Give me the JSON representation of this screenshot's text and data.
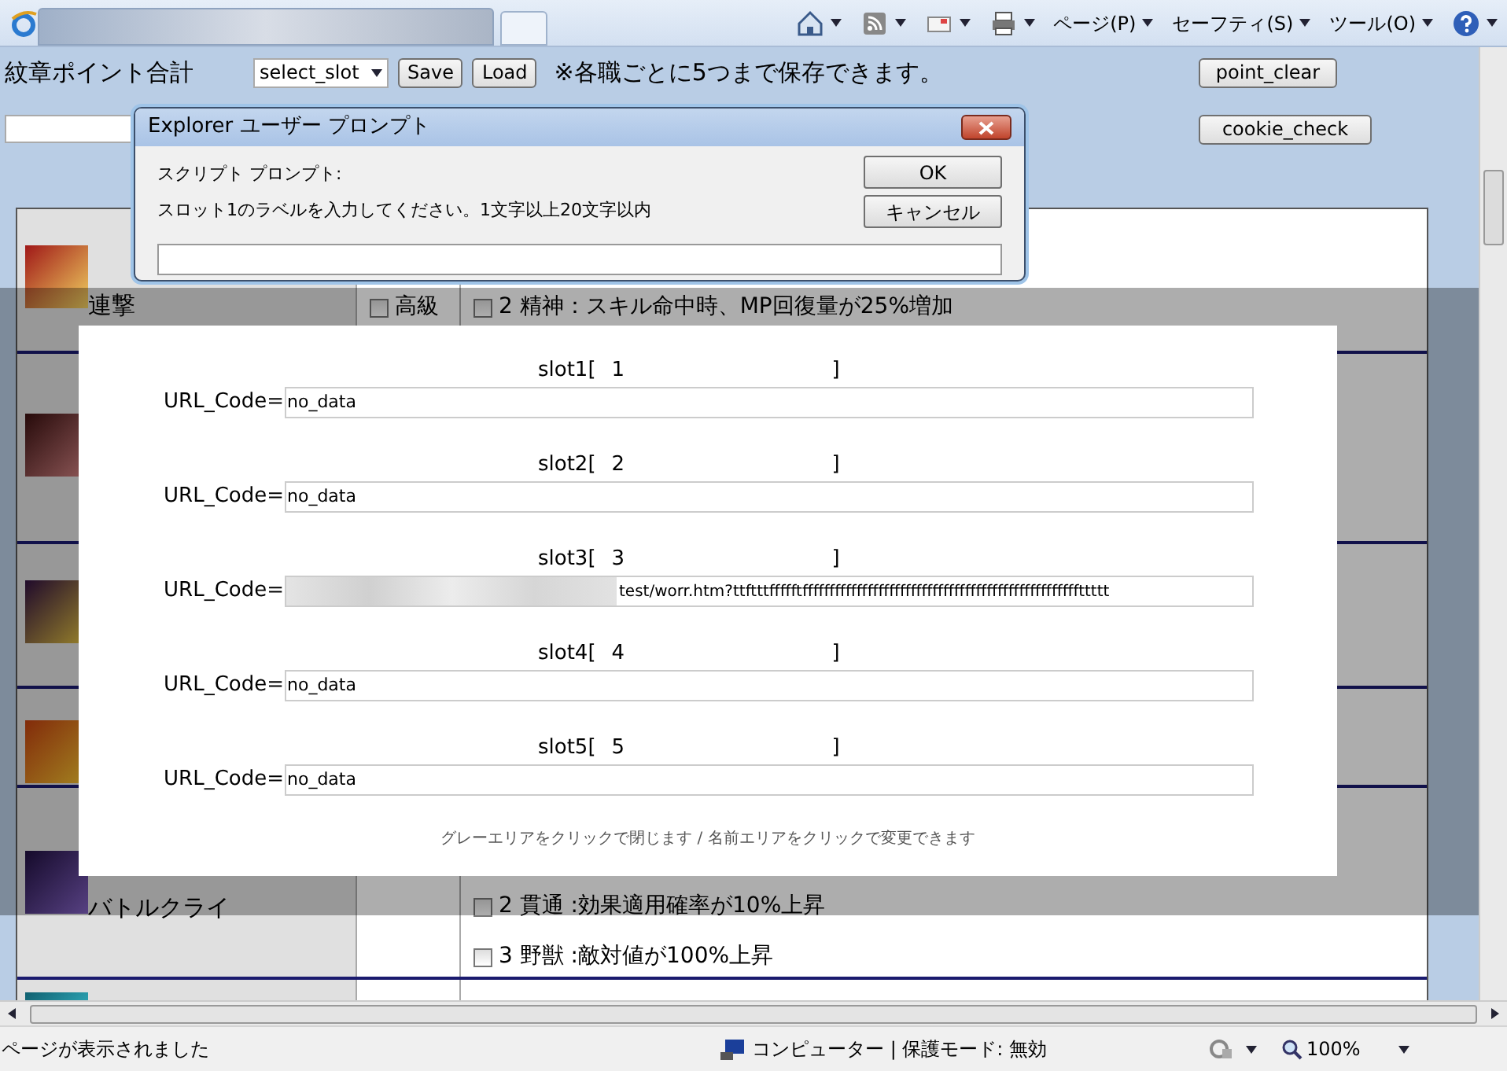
{
  "browser": {
    "menus": [
      "ページ(P)",
      "セーフティ(S)",
      "ツール(O)"
    ]
  },
  "page": {
    "title": "紋章ポイント合計",
    "slot_select": "select_slot",
    "buttons": [
      "Save",
      "Load"
    ],
    "notice": "※各職ごとに5つまで保存できます。",
    "point_clear": "point_clear",
    "cookie_check": "cookie_check"
  },
  "skills": [
    {
      "kind": "skill",
      "name": "連撃",
      "grade": "高級",
      "grade_checked": false,
      "options": [
        {
          "label": "2 精神：スキル命中時、MP回復量が25%増加",
          "checked": false
        }
      ]
    },
    {
      "kind": "covered"
    },
    {
      "kind": "covered"
    },
    {
      "kind": "covered"
    },
    {
      "kind": "skill",
      "name": "バトルクライ",
      "options": [
        {
          "label": "2 貫通 :効果適用確率が10%上昇",
          "checked": false
        },
        {
          "label": "3 野獣 :敵対値が100%上昇",
          "checked": false
        }
      ]
    },
    {
      "kind": "covered"
    }
  ],
  "modal": {
    "slots": [
      {
        "label": "slot1[",
        "name": "1",
        "close": "]",
        "url_label": "URL_Code=",
        "url": "no_data",
        "redacted": false
      },
      {
        "label": "slot2[",
        "name": "2",
        "close": "]",
        "url_label": "URL_Code=",
        "url": "no_data",
        "redacted": false
      },
      {
        "label": "slot3[",
        "name": "3",
        "close": "]",
        "url_label": "URL_Code=",
        "url": "test/worr.htm?ttftttffffftfffffffffffffffffffffffffffffffffffffffffffffffffffttttt",
        "redacted": true
      },
      {
        "label": "slot4[",
        "name": "4",
        "close": "]",
        "url_label": "URL_Code=",
        "url": "no_data",
        "redacted": false
      },
      {
        "label": "slot5[",
        "name": "5",
        "close": "]",
        "url_label": "URL_Code=",
        "url": "no_data",
        "redacted": false
      }
    ],
    "footer": "グレーエリアをクリックで閉じます / 名前エリアをクリックで変更できます"
  },
  "dialog": {
    "title": "Explorer ユーザー プロンプト",
    "label": "スクリプト プロンプト:",
    "message": "スロット1のラベルを入力してください。1文字以上20文字以内",
    "buttons": [
      "OK",
      "キャンセル"
    ]
  },
  "status_bar": {
    "text": "ページが表示されました",
    "zone": "コンピューター | 保護モード: 無効",
    "zoom": "100%"
  }
}
